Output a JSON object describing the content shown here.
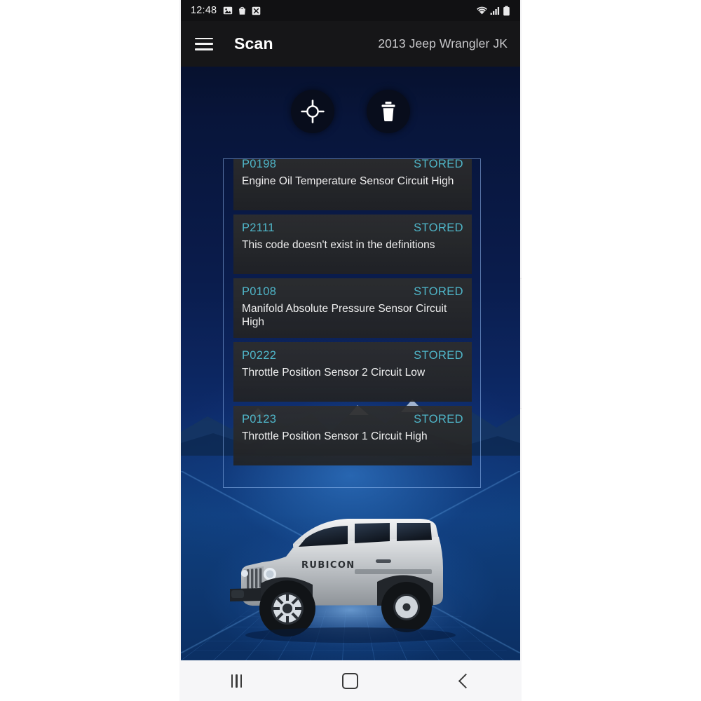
{
  "status_bar": {
    "time": "12:48",
    "left_icons": [
      "image-icon",
      "shopping-bag-icon",
      "x-box-icon"
    ],
    "right_icons": [
      "wifi-icon",
      "cellular-signal-icon",
      "battery-icon"
    ]
  },
  "app_bar": {
    "menu_icon": "hamburger-menu-icon",
    "title": "Scan",
    "vehicle": "2013 Jeep Wrangler JK"
  },
  "actions": [
    {
      "name": "scan-button",
      "icon": "crosshair-target-icon"
    },
    {
      "name": "clear-codes-button",
      "icon": "trash-icon"
    }
  ],
  "dtc_list": {
    "items": [
      {
        "code": "P0198",
        "status": "STORED",
        "description": "Engine Oil Temperature Sensor Circuit High"
      },
      {
        "code": "P2111",
        "status": "STORED",
        "description": "This code doesn't exist in the definitions"
      },
      {
        "code": "P0108",
        "status": "STORED",
        "description": "Manifold Absolute Pressure Sensor Circuit High"
      },
      {
        "code": "P0222",
        "status": "STORED",
        "description": "Throttle Position Sensor 2 Circuit Low"
      },
      {
        "code": "P0123",
        "status": "STORED",
        "description": "Throttle Position Sensor 1 Circuit High"
      }
    ]
  },
  "vehicle_image": {
    "alt": "silver-jeep-wrangler-rubicon",
    "badge_text": "RUBICON"
  },
  "nav_bar": {
    "recents_label": "recents",
    "home_label": "home",
    "back_label": "back"
  },
  "colors": {
    "code_accent": "#4fb6c9",
    "status_accent": "#4fb6c9",
    "app_bar_bg": "#161618",
    "status_bar_bg": "#111113",
    "card_bg": "#2e2e2e",
    "frame_border": "#96bef5",
    "nav_bar_bg": "#f6f6f8"
  }
}
